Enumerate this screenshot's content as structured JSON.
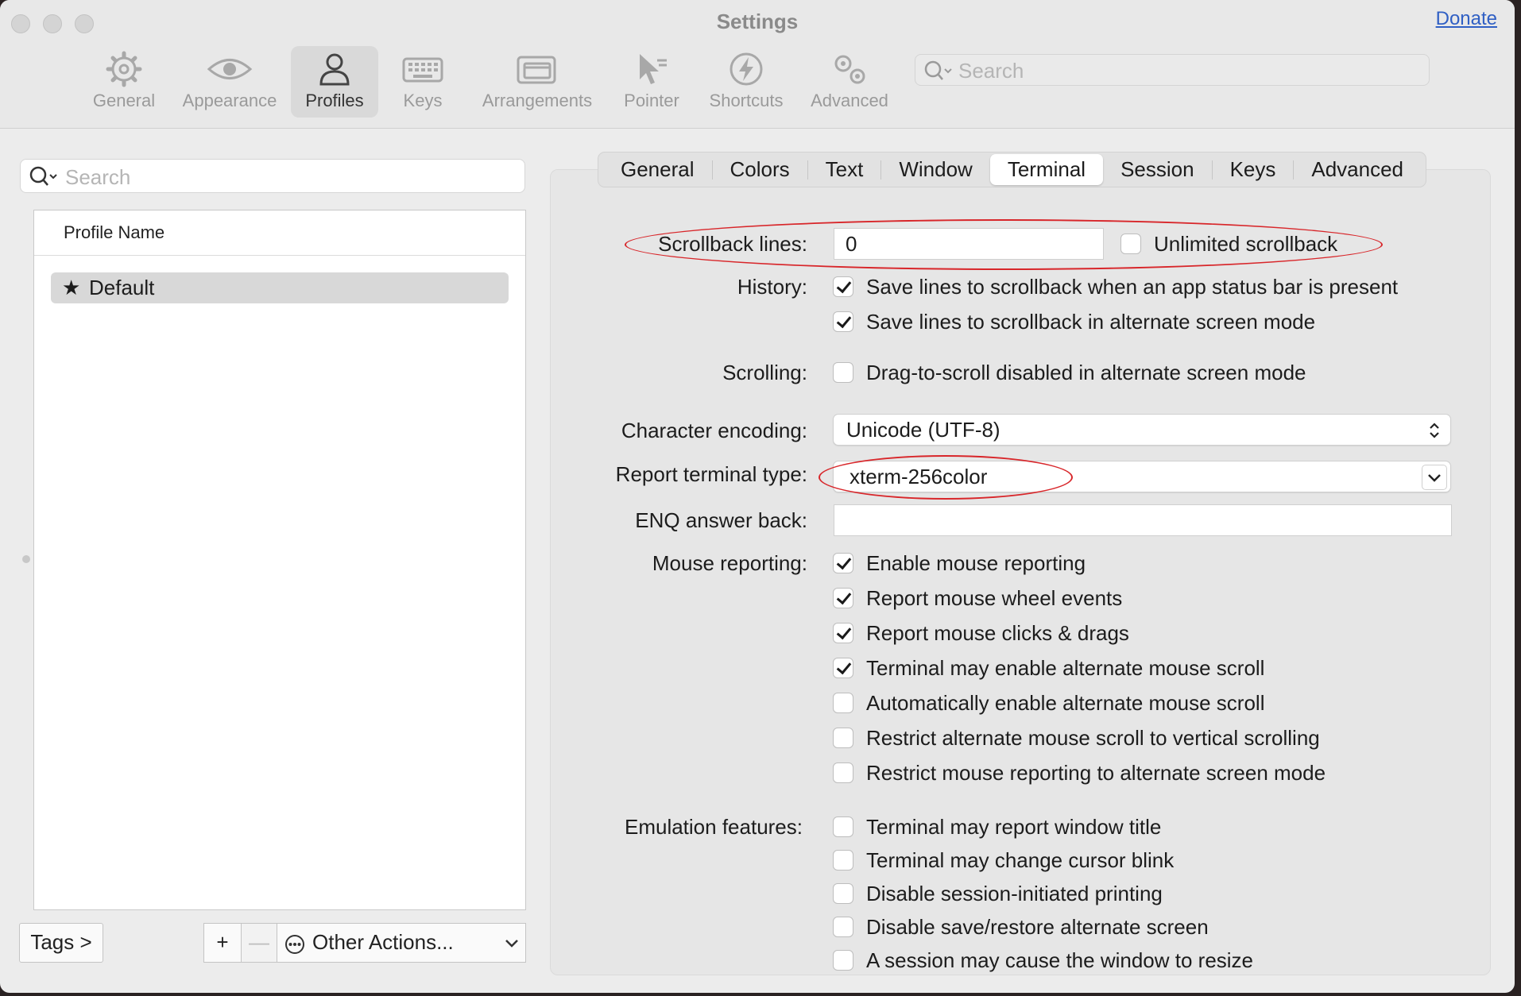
{
  "window": {
    "title": "Settings",
    "donate_label": "Donate"
  },
  "toolbar": {
    "items": [
      {
        "label": "General",
        "icon": "gear-icon"
      },
      {
        "label": "Appearance",
        "icon": "eye-icon"
      },
      {
        "label": "Profiles",
        "icon": "person-icon"
      },
      {
        "label": "Keys",
        "icon": "keyboard-icon"
      },
      {
        "label": "Arrangements",
        "icon": "windows-icon"
      },
      {
        "label": "Pointer",
        "icon": "pointer-icon"
      },
      {
        "label": "Shortcuts",
        "icon": "bolt-icon"
      },
      {
        "label": "Advanced",
        "icon": "gears-icon"
      }
    ],
    "active": "Profiles",
    "search_placeholder": "Search"
  },
  "sidebar": {
    "search_placeholder": "Search",
    "column_header": "Profile Name",
    "profiles": [
      {
        "name": "Default",
        "default_marker": "★"
      }
    ],
    "tags_label": "Tags >",
    "add_label": "+",
    "remove_label": "—",
    "other_actions_label": "Other Actions..."
  },
  "tabs": {
    "items": [
      "General",
      "Colors",
      "Text",
      "Window",
      "Terminal",
      "Session",
      "Keys",
      "Advanced"
    ],
    "active": "Terminal"
  },
  "terminal": {
    "scrollback_label": "Scrollback lines:",
    "scrollback_value": "0",
    "unlimited_label": "Unlimited scrollback",
    "unlimited_checked": false,
    "history_label": "History:",
    "history_options": [
      {
        "label": "Save lines to scrollback when an app status bar is present",
        "checked": true
      },
      {
        "label": "Save lines to scrollback in alternate screen mode",
        "checked": true
      }
    ],
    "scrolling_label": "Scrolling:",
    "scrolling_option": {
      "label": "Drag-to-scroll disabled in alternate screen mode",
      "checked": false
    },
    "encoding_label": "Character encoding:",
    "encoding_value": "Unicode (UTF-8)",
    "term_type_label": "Report terminal type:",
    "term_type_value": "xterm-256color",
    "enq_label": "ENQ answer back:",
    "enq_value": "",
    "mouse_label": "Mouse reporting:",
    "mouse_options": [
      {
        "label": "Enable mouse reporting",
        "checked": true
      },
      {
        "label": "Report mouse wheel events",
        "checked": true
      },
      {
        "label": "Report mouse clicks & drags",
        "checked": true
      },
      {
        "label": "Terminal may enable alternate mouse scroll",
        "checked": true
      },
      {
        "label": "Automatically enable alternate mouse scroll",
        "checked": false
      },
      {
        "label": "Restrict alternate mouse scroll to vertical scrolling",
        "checked": false
      },
      {
        "label": "Restrict mouse reporting to alternate screen mode",
        "checked": false
      }
    ],
    "emulation_label": "Emulation features:",
    "emulation_options": [
      {
        "label": "Terminal may report window title",
        "checked": false
      },
      {
        "label": "Terminal may change cursor blink",
        "checked": false
      },
      {
        "label": "Disable session-initiated printing",
        "checked": false
      },
      {
        "label": "Disable save/restore alternate screen",
        "checked": false
      },
      {
        "label": "A session may cause the window to resize",
        "checked": false
      }
    ]
  },
  "annotation_color": "#d8262a"
}
